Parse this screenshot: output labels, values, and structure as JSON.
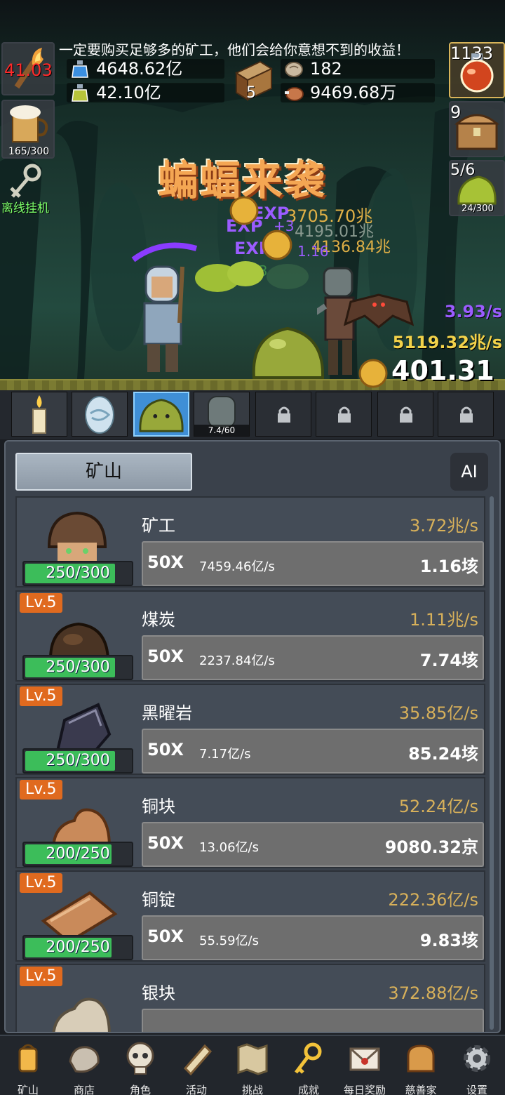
{
  "scene": {
    "tip": "一定要购买足够多的矿工，他们会给你意想不到的收益！",
    "resources": {
      "potion_blue": "4648.62亿",
      "potion_green": "42.10亿",
      "book_count": "5",
      "stone": "182",
      "meat": "9469.68万"
    },
    "left": {
      "torch_value": "41.03",
      "beer_progress": "165/300",
      "offline_label": "离线挂机"
    },
    "right": {
      "potion_count": "1133",
      "chest_count": "9",
      "slime_count": "5/6",
      "slime_progress": "24/300"
    },
    "event_title": "蝙蝠来袭",
    "floats": {
      "exp1": "EXP",
      "exp2": "EXP",
      "exp3": "EXP",
      "val1": "3705.70兆",
      "val2": "4195.01兆",
      "val3": "4136.84兆",
      "plus1": "+3",
      "plus2": "1.16",
      "plus3": "+3"
    },
    "rate_per_sec": "3.93/s",
    "gold_per_sec": "5119.32兆/s",
    "coin_total": "401.31京"
  },
  "monster_bar": {
    "zombie_progress": "7.4/60"
  },
  "panel": {
    "tab_label": "矿山",
    "ai_label": "AI",
    "rows": [
      {
        "level": "",
        "progress": "250/300",
        "progress_fraction": 0.83,
        "name": "矿工",
        "rate": "3.72兆/s",
        "mult": "50X",
        "per": "7459.46亿/s",
        "cost": "1.16垓"
      },
      {
        "level": "Lv.5",
        "progress": "250/300",
        "progress_fraction": 0.83,
        "name": "煤炭",
        "rate": "1.11兆/s",
        "mult": "50X",
        "per": "2237.84亿/s",
        "cost": "7.74垓"
      },
      {
        "level": "Lv.5",
        "progress": "250/300",
        "progress_fraction": 0.83,
        "name": "黑曜岩",
        "rate": "35.85亿/s",
        "mult": "50X",
        "per": "7.17亿/s",
        "cost": "85.24垓"
      },
      {
        "level": "Lv.5",
        "progress": "200/250",
        "progress_fraction": 0.8,
        "name": "铜块",
        "rate": "52.24亿/s",
        "mult": "50X",
        "per": "13.06亿/s",
        "cost": "9080.32京"
      },
      {
        "level": "Lv.5",
        "progress": "200/250",
        "progress_fraction": 0.8,
        "name": "铜锭",
        "rate": "222.36亿/s",
        "mult": "50X",
        "per": "55.59亿/s",
        "cost": "9.83垓"
      },
      {
        "level": "Lv.5",
        "progress": "",
        "progress_fraction": 0,
        "name": "银块",
        "rate": "372.88亿/s",
        "mult": "",
        "per": "",
        "cost": ""
      }
    ]
  },
  "nav": [
    "矿山",
    "商店",
    "角色",
    "活动",
    "挑战",
    "成就",
    "每日奖励",
    "慈善家",
    "设置"
  ]
}
